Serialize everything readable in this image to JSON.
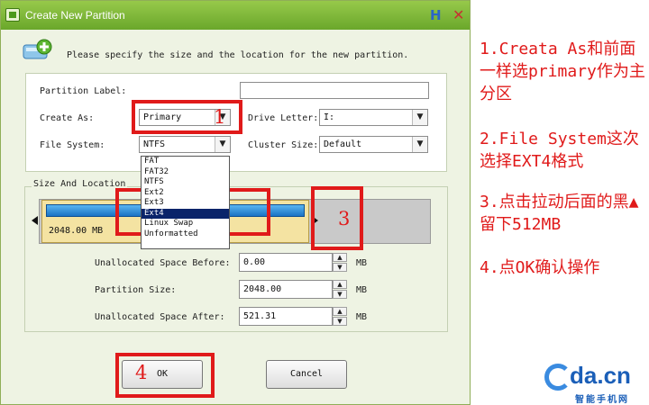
{
  "window": {
    "title": "Create New Partition",
    "help_glyph": "H",
    "close_glyph": "✕"
  },
  "instruction": "Please specify the size and the location for the new partition.",
  "form": {
    "partition_label": {
      "label": "Partition Label:",
      "value": ""
    },
    "create_as": {
      "label": "Create As:",
      "value": "Primary"
    },
    "drive_letter": {
      "label": "Drive Letter:",
      "value": "I:"
    },
    "file_system": {
      "label": "File System:",
      "value": "NTFS",
      "options": [
        "FAT",
        "FAT32",
        "NTFS",
        "Ext2",
        "Ext3",
        "Ext4",
        "Linux Swap",
        "Unformatted"
      ],
      "highlighted": "Ext4"
    },
    "cluster_size": {
      "label": "Cluster Size:",
      "value": "Default"
    }
  },
  "size_location": {
    "group_title": "Size And Location",
    "bar_text": "2048.00 MB",
    "unit": "MB",
    "unallocated_before": {
      "label": "Unallocated Space Before:",
      "value": "0.00"
    },
    "partition_size": {
      "label": "Partition Size:",
      "value": "2048.00"
    },
    "unallocated_after": {
      "label": "Unallocated Space After:",
      "value": "521.31"
    }
  },
  "buttons": {
    "ok": "OK",
    "cancel": "Cancel"
  },
  "annotations": [
    "1",
    "2",
    "3",
    "4"
  ],
  "notes": [
    "1.Creata As和前面一样选primary作为主分区",
    "2.File System这次选择EXT4格式",
    "3.点击拉动后面的黑▲留下512MB",
    "4.点OK确认操作"
  ],
  "logo": {
    "text": "da.cn",
    "subtitle": "智能手机网"
  },
  "colors": {
    "titlebar": "#7ab535",
    "annotation": "#e01a1a",
    "selection": "#0a246a"
  }
}
